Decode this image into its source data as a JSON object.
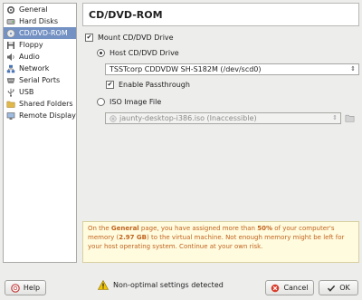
{
  "sidebar": {
    "items": [
      {
        "label": "General",
        "icon": "gear-icon"
      },
      {
        "label": "Hard Disks",
        "icon": "hard-disk-icon"
      },
      {
        "label": "CD/DVD-ROM",
        "icon": "cd-dvd-icon",
        "selected": true
      },
      {
        "label": "Floppy",
        "icon": "floppy-icon"
      },
      {
        "label": "Audio",
        "icon": "audio-icon"
      },
      {
        "label": "Network",
        "icon": "network-icon"
      },
      {
        "label": "Serial Ports",
        "icon": "serial-port-icon"
      },
      {
        "label": "USB",
        "icon": "usb-icon"
      },
      {
        "label": "Shared Folders",
        "icon": "shared-folder-icon"
      },
      {
        "label": "Remote Display",
        "icon": "remote-display-icon"
      }
    ]
  },
  "page": {
    "title": "CD/DVD-ROM",
    "mount_label": "Mount CD/DVD Drive",
    "mount_checked": true,
    "host_drive_label": "Host CD/DVD Drive",
    "host_drive_selected": true,
    "host_drive_value": "TSSTcorp CDDVDW SH-S182M (/dev/scd0)",
    "passthrough_label": "Enable Passthrough",
    "passthrough_checked": true,
    "iso_label": "ISO Image File",
    "iso_selected": false,
    "iso_value": "jaunty-desktop-i386.iso (Inaccessible)"
  },
  "warning": {
    "p1": "On the ",
    "p2": "General",
    "p3": " page, you have assigned more than ",
    "p4": "50%",
    "p5": " of your computer's memory (",
    "p6": "2.97 GB",
    "p7": ") to the virtual machine. Not enough memory might be left for your host operating system. Continue at your own risk."
  },
  "footer": {
    "help_label": "Help",
    "status_text": "Non-optimal settings detected",
    "cancel_label": "Cancel",
    "ok_label": "OK"
  },
  "colors": {
    "selection": "#7391c3",
    "warning_text": "#c1631e",
    "warning_bg": "#fffbde"
  }
}
